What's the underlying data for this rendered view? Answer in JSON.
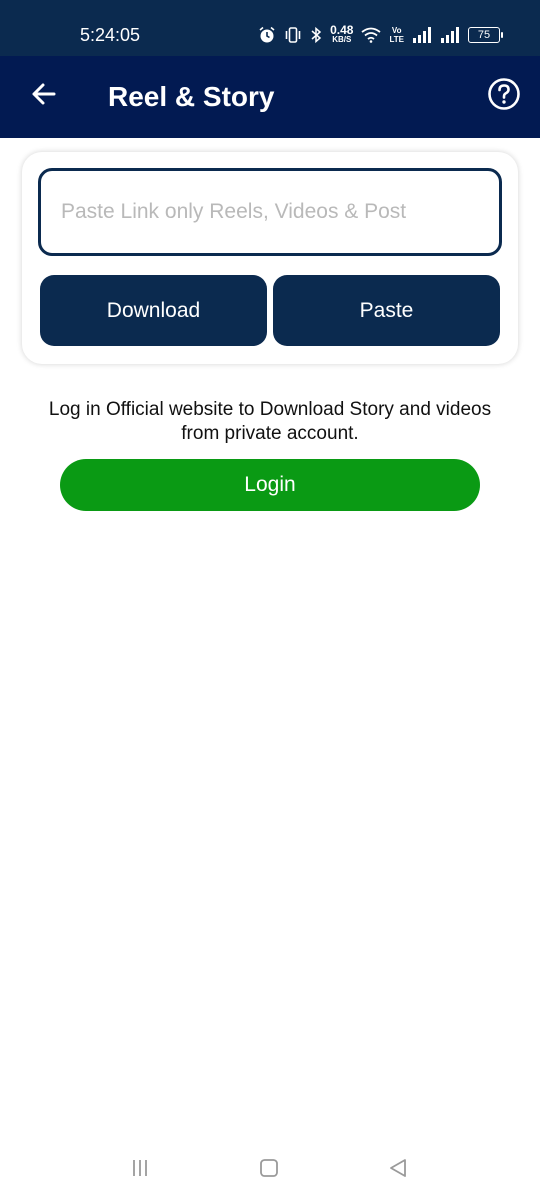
{
  "status_bar": {
    "time": "5:24:05",
    "net_speed_value": "0.48",
    "net_speed_unit": "KB/S",
    "volte_top": "Vo",
    "volte_bottom": "LTE",
    "battery_level": "75",
    "icons": [
      "alarm-icon",
      "vibrate-icon",
      "bluetooth-icon",
      "wifi-icon",
      "signal-icon",
      "signal-icon",
      "battery-icon"
    ]
  },
  "app_bar": {
    "title": "Reel & Story",
    "back_icon": "arrow-left-icon",
    "help_icon": "help-circle-icon"
  },
  "card": {
    "input_placeholder": "Paste Link only Reels, Videos & Post",
    "input_value": "",
    "download_label": "Download",
    "paste_label": "Paste"
  },
  "info": {
    "message_line1": "Log in Official website to Download Story and videos",
    "message_line2": "from private account.",
    "login_label": "Login"
  },
  "nav_bar": {
    "icons": [
      "menu-icon",
      "home-icon",
      "back-icon"
    ]
  },
  "colors": {
    "status_bar_bg": "#0b2a4f",
    "app_bar_bg": "#021a52",
    "button_dark": "#0b2a4f",
    "login_green": "#0a9a14",
    "background": "#ffffff"
  }
}
